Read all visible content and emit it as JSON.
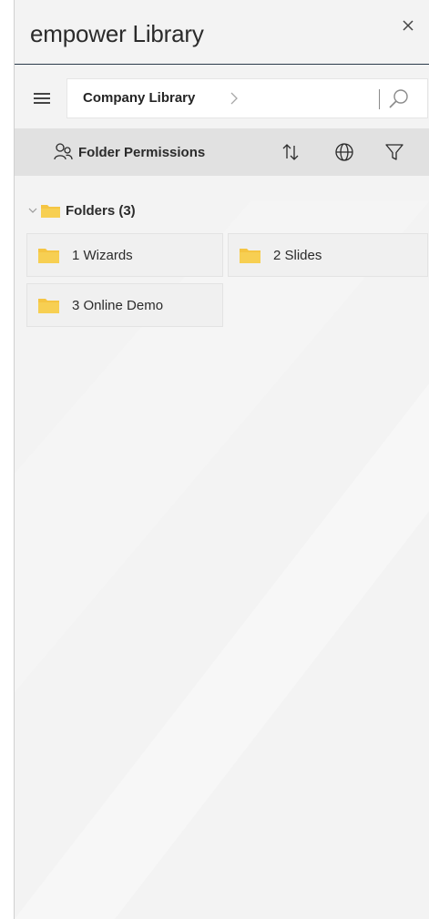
{
  "window": {
    "title": "empower Library"
  },
  "navbar": {
    "breadcrumb": "Company Library"
  },
  "toolbar": {
    "permissions_label": "Folder Permissions"
  },
  "folders_section": {
    "label": "Folders (3)",
    "items": [
      {
        "label": "1 Wizards"
      },
      {
        "label": "2 Slides"
      },
      {
        "label": "3 Online Demo"
      }
    ]
  },
  "icons": {
    "close": "close-icon",
    "menu": "hamburger-icon",
    "breadcrumb_chevron": "chevron-right-icon",
    "search": "search-icon",
    "permissions": "people-icon",
    "sort": "sort-icon",
    "globe": "globe-icon",
    "filter": "filter-icon",
    "collapse": "chevron-down-icon",
    "folder": "folder-icon"
  },
  "colors": {
    "accent_line": "#2b3a4a",
    "folder": "#f5c542",
    "toolbar_bg": "#e1e1e1",
    "pane_bg": "#f3f3f3"
  }
}
